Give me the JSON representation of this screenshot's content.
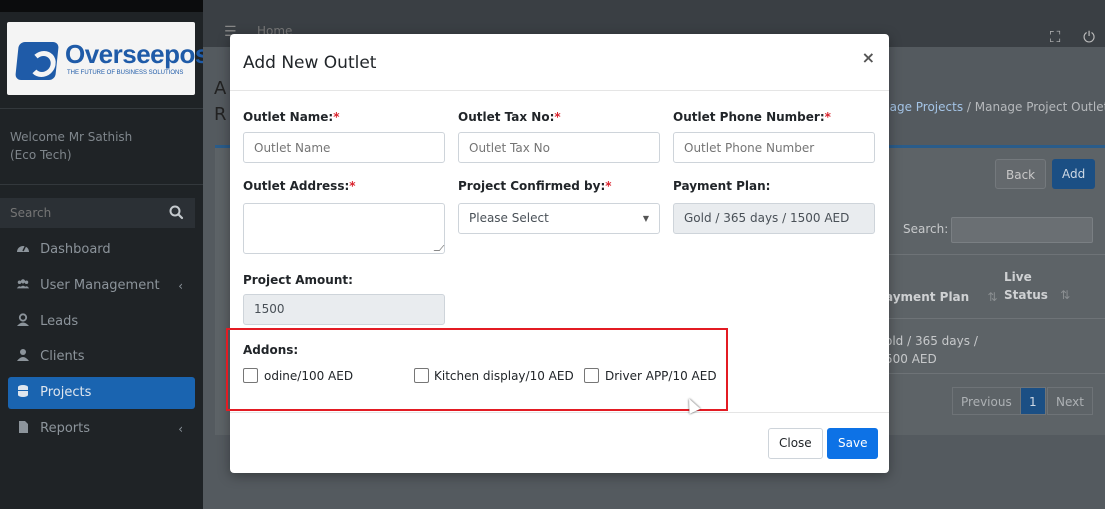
{
  "brand": {
    "name": "Overseepos",
    "tagline": "THE FUTURE OF BUSINESS SOLUTIONS",
    "color": "#1f5ba8"
  },
  "sidebar": {
    "welcome_line1": "Welcome Mr Sathish",
    "welcome_line2": "(Eco Tech)",
    "search_placeholder": "Search",
    "items": [
      {
        "label": "Dashboard",
        "icon": "dashboard-icon",
        "has_chevron": false
      },
      {
        "label": "User Management",
        "icon": "users-icon",
        "has_chevron": true
      },
      {
        "label": "Leads",
        "icon": "leads-icon",
        "has_chevron": false
      },
      {
        "label": "Clients",
        "icon": "client-icon",
        "has_chevron": false
      },
      {
        "label": "Projects",
        "icon": "database-icon",
        "has_chevron": false,
        "active": true
      },
      {
        "label": "Reports",
        "icon": "report-icon",
        "has_chevron": true
      }
    ]
  },
  "topbar": {
    "home": "Home"
  },
  "background": {
    "breadcrumb_link": "nage Projects",
    "breadcrumb_sep": " / ",
    "breadcrumb_current": "Manage Project Outlet",
    "back_label": "Back",
    "add_label": "Add",
    "search_label": "Search:",
    "col_payment": "ayment Plan",
    "col_live_1": "Live",
    "col_live_2": "Status",
    "row_payment_1": "old / 365 days /",
    "row_payment_2": "500 AED",
    "prev_label": "Previous",
    "page_num": "1",
    "next_label": "Next",
    "left_a": "A",
    "left_r": "R"
  },
  "modal": {
    "title": "Add New Outlet",
    "close_symbol": "×",
    "outlet_name_label": "Outlet Name:",
    "outlet_name_placeholder": "Outlet Name",
    "outlet_tax_label": "Outlet Tax No:",
    "outlet_tax_placeholder": "Outlet Tax No",
    "outlet_phone_label": "Outlet Phone Number:",
    "outlet_phone_placeholder": "Outlet Phone Number",
    "outlet_address_label": "Outlet Address:",
    "confirmed_by_label": "Project Confirmed by:",
    "confirmed_by_value": "Please Select",
    "payment_plan_label": "Payment Plan:",
    "payment_plan_value": "Gold / 365 days / 1500 AED",
    "project_amount_label": "Project Amount:",
    "project_amount_value": "1500",
    "required_mark": "*",
    "addons_label": "Addons:",
    "addons": [
      {
        "label": "odine/100 AED",
        "checked": false
      },
      {
        "label": "Kitchen display/10 AED",
        "checked": false
      },
      {
        "label": "Driver APP/10 AED",
        "checked": false
      }
    ],
    "close_button": "Close",
    "save_button": "Save",
    "highlight_color": "#e31b23",
    "primary_color": "#0d72e6"
  }
}
